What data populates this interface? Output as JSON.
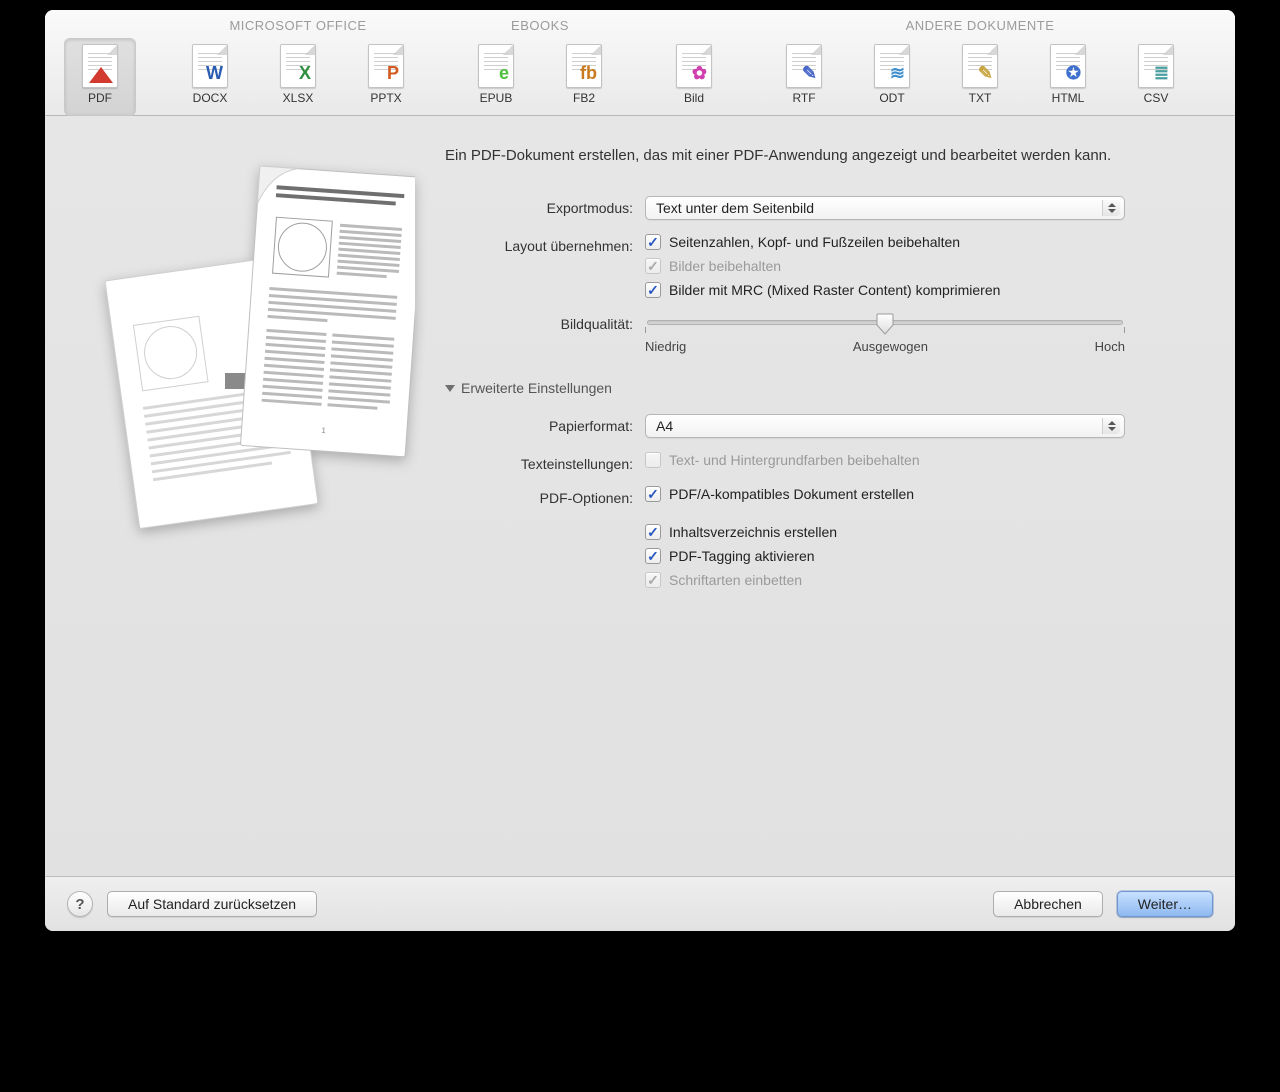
{
  "toolbar": {
    "groups": [
      {
        "title": "",
        "items": [
          {
            "label": "PDF",
            "color": "#d23a2f",
            "glyph": ""
          }
        ]
      },
      {
        "title": "MICROSOFT OFFICE",
        "items": [
          {
            "label": "DOCX",
            "color": "#2a5db0",
            "glyph": "W"
          },
          {
            "label": "XLSX",
            "color": "#2f8f3f",
            "glyph": "X"
          },
          {
            "label": "PPTX",
            "color": "#d25a22",
            "glyph": "P"
          }
        ]
      },
      {
        "title": "EBOOKS",
        "items": [
          {
            "label": "EPUB",
            "color": "#4fbf3f",
            "glyph": "e"
          },
          {
            "label": "FB2",
            "color": "#c97a1e",
            "glyph": "fb"
          }
        ]
      },
      {
        "title": "",
        "items": [
          {
            "label": "Bild",
            "color": "#cf3fae",
            "glyph": "✿"
          }
        ]
      },
      {
        "title": "ANDERE DOKUMENTE",
        "items": [
          {
            "label": "RTF",
            "color": "#4766c9",
            "glyph": "✎"
          },
          {
            "label": "ODT",
            "color": "#3f8fcf",
            "glyph": "≋"
          },
          {
            "label": "TXT",
            "color": "#c9a53f",
            "glyph": "✎"
          },
          {
            "label": "HTML",
            "color": "#3f6fcf",
            "glyph": "✪"
          },
          {
            "label": "CSV",
            "color": "#4a9fa0",
            "glyph": "≣"
          }
        ]
      }
    ],
    "selected": "PDF"
  },
  "intro": "Ein PDF-Dokument erstellen, das mit einer PDF-Anwendung angezeigt und bearbeitet werden kann.",
  "labels": {
    "exportmode": "Exportmodus:",
    "layout": "Layout übernehmen:",
    "imagequality": "Bildqualität:",
    "advanced": "Erweiterte Einstellungen",
    "paperformat": "Papierformat:",
    "textsettings": "Texteinstellungen:",
    "pdfoptions": "PDF-Optionen:"
  },
  "exportmode": {
    "value": "Text unter dem Seitenbild"
  },
  "layout": {
    "keep_headers": "Seitenzahlen, Kopf- und Fußzeilen beibehalten",
    "keep_images": "Bilder beibehalten",
    "mrc": "Bilder mit MRC (Mixed Raster Content) komprimieren"
  },
  "quality": {
    "low": "Niedrig",
    "mid": "Ausgewogen",
    "high": "Hoch"
  },
  "paperformat": {
    "value": "A4"
  },
  "textsettings": {
    "keep_colors": "Text- und Hintergrundfarben beibehalten"
  },
  "pdfoptions": {
    "pdfa": "PDF/A-kompatibles Dokument erstellen",
    "toc": "Inhaltsverzeichnis erstellen",
    "tagging": "PDF-Tagging aktivieren",
    "embed_fonts": "Schriftarten einbetten"
  },
  "bottom": {
    "reset": "Auf Standard zurücksetzen",
    "cancel": "Abbrechen",
    "next": "Weiter…"
  }
}
